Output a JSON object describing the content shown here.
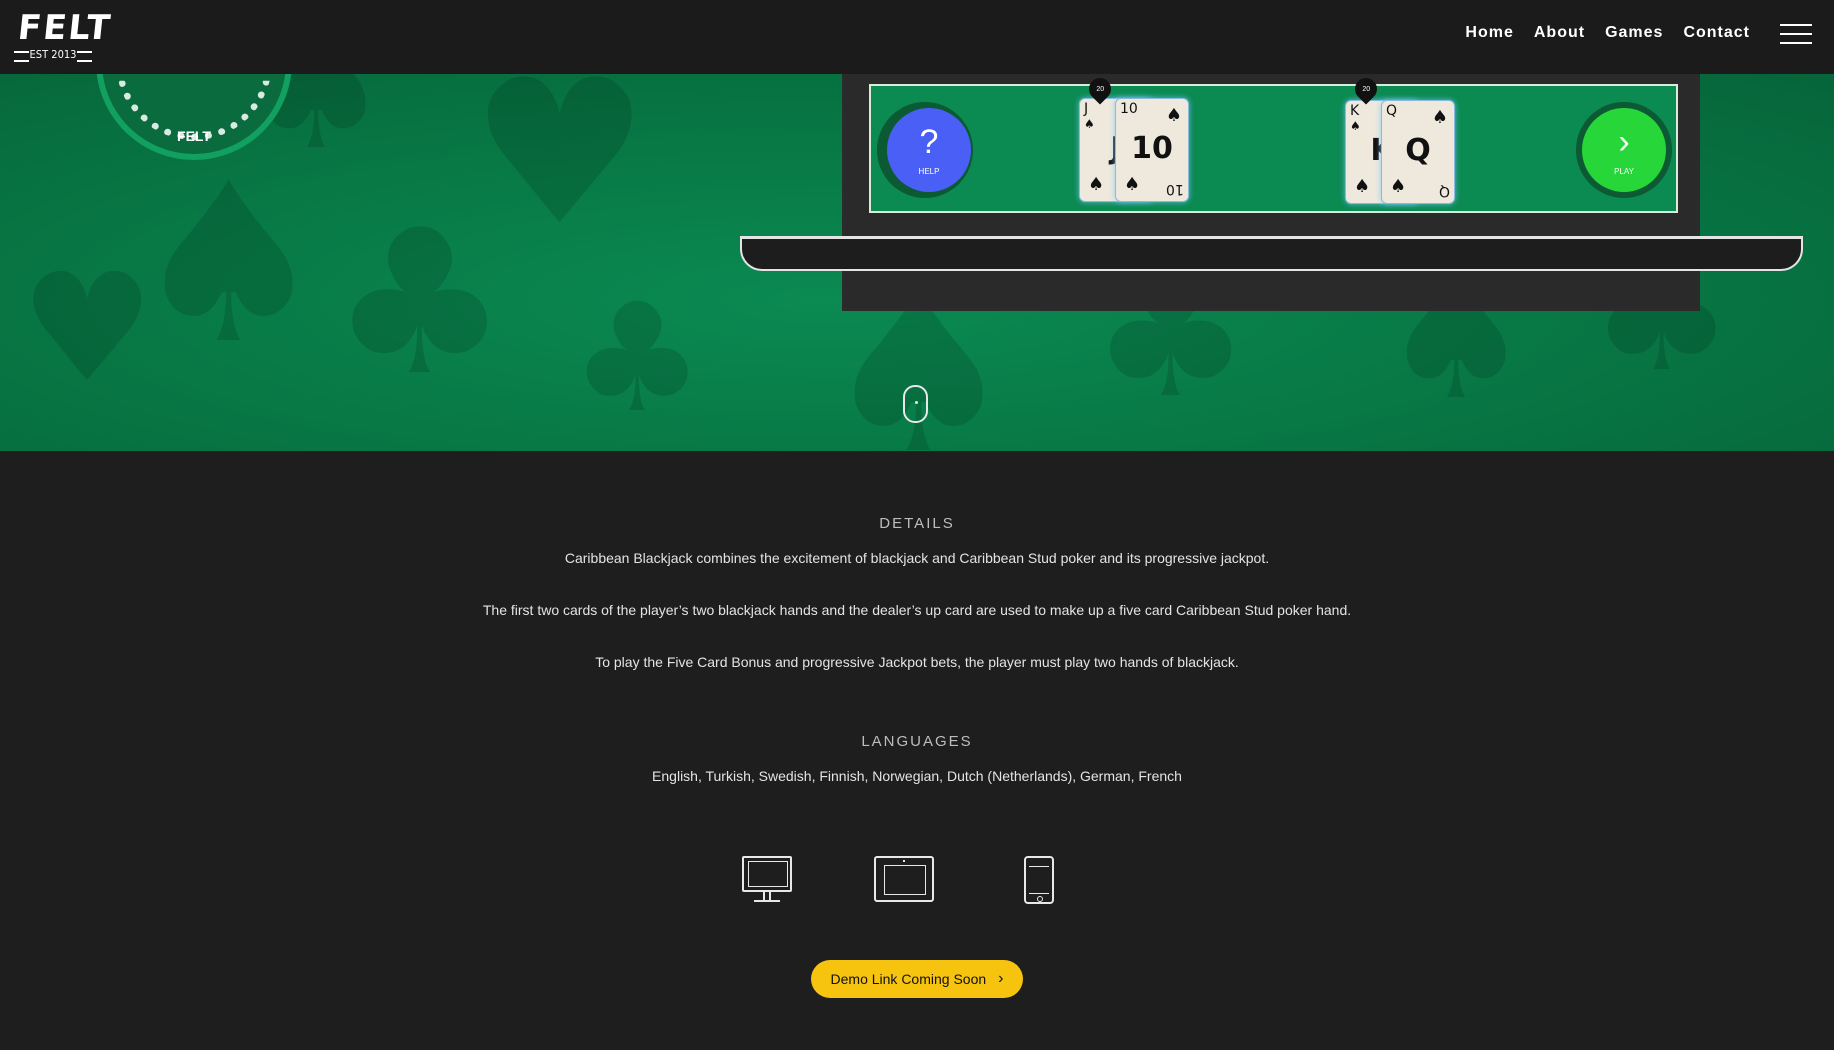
{
  "logo": {
    "word": "FELT",
    "est": "EST 2013"
  },
  "nav": {
    "items": [
      "Home",
      "About",
      "Games",
      "Contact"
    ]
  },
  "badge": {
    "label": "FELT"
  },
  "game": {
    "help_glyph": "?",
    "help_label": "HELP",
    "play_glyph": "›",
    "play_label": "PLAY",
    "hand1": {
      "marker": "20",
      "card_back": {
        "rank": "J",
        "center": "J",
        "suit": "♠"
      },
      "card_front": {
        "rank": "10",
        "center": "10",
        "suit": "♠",
        "rank_br": "10"
      }
    },
    "hand2": {
      "marker": "20",
      "card_back": {
        "rank": "K",
        "center": "K",
        "suit": "♠"
      },
      "card_front": {
        "rank": "Q",
        "center": "Q",
        "suit": "♠",
        "rank_br": "Q"
      }
    }
  },
  "details": {
    "heading": "DETAILS",
    "paragraphs": [
      "Caribbean Blackjack combines the excitement of blackjack and Caribbean Stud poker and its progressive jackpot.",
      "The first two cards of the player’s two blackjack hands and the dealer’s up card are used to make up a five card Caribbean Stud poker hand.",
      "To play the Five Card Bonus and progressive Jackpot bets, the player must play two hands of blackjack."
    ]
  },
  "languages": {
    "heading": "LANGUAGES",
    "list": "English, Turkish, Swedish, Finnish, Norwegian, Dutch (Netherlands), German, French"
  },
  "devices": [
    "desktop-icon",
    "tablet-icon",
    "phone-icon"
  ],
  "demo_button": {
    "label": "Demo Link Coming Soon",
    "chevron": "›"
  },
  "colors": {
    "header_bg": "#1b1b1b",
    "felt_green": "#087a46",
    "help_blue": "#4a5ff5",
    "play_green": "#27d639",
    "accent_yellow": "#f6c40e",
    "content_bg": "#1e1e1e"
  }
}
